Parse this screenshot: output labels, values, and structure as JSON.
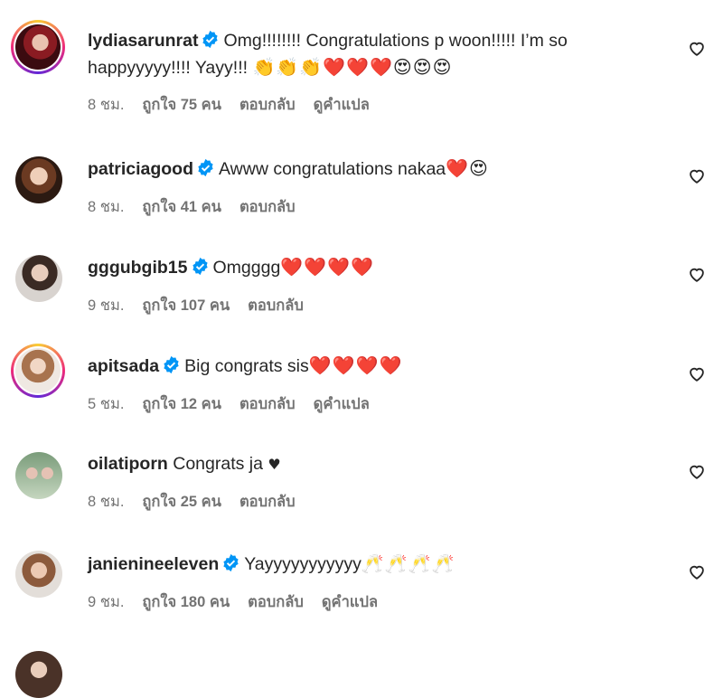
{
  "comments": [
    {
      "username": "lydiasarunrat",
      "verified": true,
      "text": "Omg!!!!!!!! Congratulations p woon!!!!! I’m so happyyyyy!!!! Yayy!!!",
      "emoji": "👏👏👏❤️❤️❤️😍😍😍",
      "time": "8 ชม.",
      "likes": "ถูกใจ 75 คน",
      "reply": "ตอบกลับ",
      "translate": "ดูคำแปล"
    },
    {
      "username": "patriciagood",
      "verified": true,
      "text": "Awww congratulations nakaa",
      "emoji": "❤️😍",
      "time": "8 ชม.",
      "likes": "ถูกใจ 41 คน",
      "reply": "ตอบกลับ"
    },
    {
      "username": "gggubgib15",
      "verified": true,
      "text": "Omgggg",
      "emoji": "❤️❤️❤️❤️",
      "time": "9 ชม.",
      "likes": "ถูกใจ 107 คน",
      "reply": "ตอบกลับ"
    },
    {
      "username": "apitsada",
      "verified": true,
      "text": "Big congrats sis",
      "emoji": "❤️❤️❤️❤️",
      "time": "5 ชม.",
      "likes": "ถูกใจ 12 คน",
      "reply": "ตอบกลับ",
      "translate": "ดูคำแปล"
    },
    {
      "username": "oilatiporn",
      "verified": false,
      "text": "Congrats ja",
      "emoji": "♥",
      "time": "8 ชม.",
      "likes": "ถูกใจ 25 คน",
      "reply": "ตอบกลับ"
    },
    {
      "username": "janienineeleven",
      "verified": true,
      "text": "Yayyyyyyyyyyy",
      "emoji": "🥂🥂🥂🥂",
      "time": "9 ชม.",
      "likes": "ถูกใจ 180 คน",
      "reply": "ตอบกลับ",
      "translate": "ดูคำแปล"
    }
  ],
  "colors": {
    "verified": "#0095f6",
    "meta": "#737373",
    "text": "#262626",
    "heart_outline": "#262626"
  },
  "icons": {
    "verified": "verified-badge-icon",
    "like": "heart-outline-icon"
  }
}
